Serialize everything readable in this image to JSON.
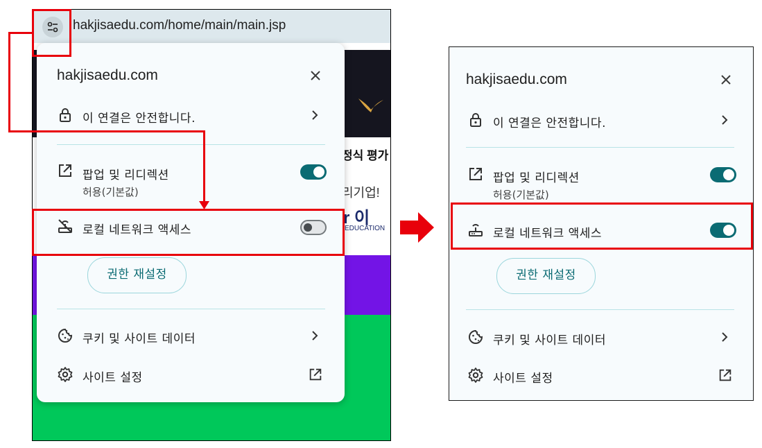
{
  "browser": {
    "url": "hakjisaedu.com/home/main/main.jsp",
    "site_info_icon": "tune-icon"
  },
  "background_page": {
    "text_line1": "정식 평가",
    "text_line2": "리기업!",
    "logo_fragment": "r 이",
    "logo_subtext": "EDUCATION",
    "colors": {
      "dark": "#15151f",
      "purple": "#7314e6",
      "green": "#00c85a"
    }
  },
  "panel_left": {
    "domain": "hakjisaedu.com",
    "connection": "이 연결은 안전합니다.",
    "popups_label": "팝업 및 리디렉션",
    "popups_status": "허용(기본값)",
    "popups_on": true,
    "local_network_label": "로컬 네트워크 액세스",
    "local_network_on": false,
    "reset_button": "권한 재설정",
    "cookies_label": "쿠키 및 사이트 데이터",
    "site_settings_label": "사이트 설정"
  },
  "panel_right": {
    "domain": "hakjisaedu.com",
    "connection": "이 연결은 안전합니다.",
    "popups_label": "팝업 및 리디렉션",
    "popups_status": "허용(기본값)",
    "popups_on": true,
    "local_network_label": "로컬 네트워크 액세스",
    "local_network_on": true,
    "reset_button": "권한 재설정",
    "cookies_label": "쿠키 및 사이트 데이터",
    "site_settings_label": "사이트 설정"
  },
  "annotation": {
    "color": "#e8000b",
    "arrow": "arrow-right-icon"
  },
  "theme": {
    "panel_bg": "#f7fbfd",
    "toggle_on": "#0b6b73",
    "divider": "#b8e3e6",
    "address_bar": "#dde8ed"
  }
}
